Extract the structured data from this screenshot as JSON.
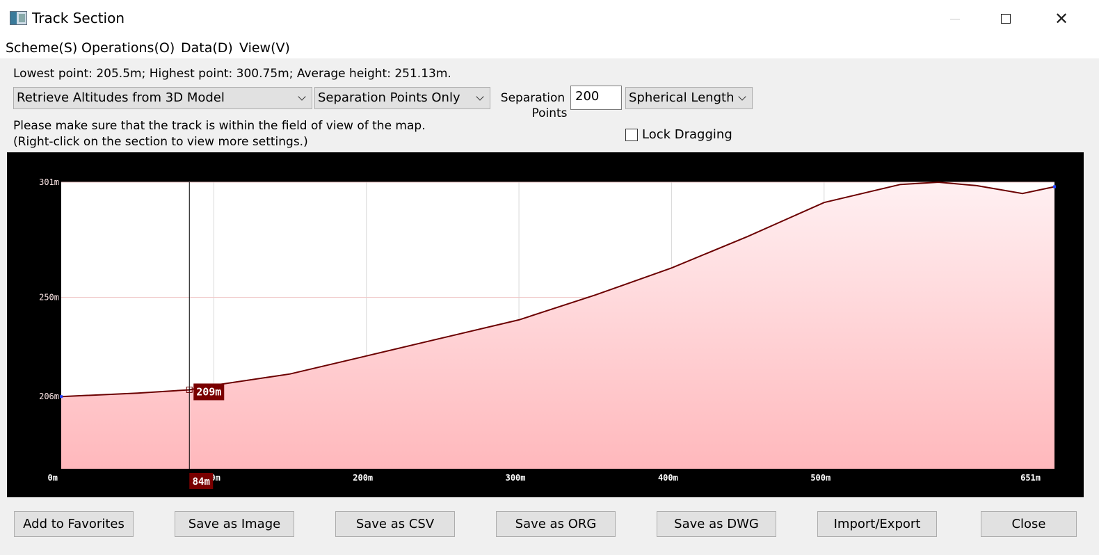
{
  "window": {
    "title": "Track Section"
  },
  "menu": [
    "Scheme(S)",
    "Operations(O)",
    "Data(D)",
    "View(V)"
  ],
  "stats": "Lowest point: 205.5m; Highest point: 300.75m; Average height: 251.13m.",
  "controls": {
    "altitude_source": "Retrieve Altitudes from 3D Model",
    "point_mode": "Separation Points Only",
    "separation_label_1": "Separation",
    "separation_label_2": "Points",
    "separation_value": "200",
    "length_mode": "Spherical Length",
    "lock_dragging": "Lock Dragging"
  },
  "hint": {
    "line1": "Please make sure that the track is within the field of view of the map.",
    "line2": "(Right-click on the section to view more settings.)"
  },
  "chart_data": {
    "type": "area",
    "y_tick_labels": [
      "301m",
      "250m",
      "206m"
    ],
    "y_ticks": [
      301,
      250,
      206
    ],
    "x_tick_labels": [
      "0m",
      "100m",
      "200m",
      "300m",
      "400m",
      "500m",
      "651m"
    ],
    "x_ticks": [
      0,
      100,
      200,
      300,
      400,
      500,
      651
    ],
    "xlim": [
      0,
      651
    ],
    "ylim": [
      174,
      301
    ],
    "x": [
      0,
      50,
      84,
      100,
      150,
      200,
      250,
      300,
      350,
      400,
      450,
      500,
      550,
      575,
      600,
      630,
      651
    ],
    "y": [
      206,
      207.5,
      209,
      211,
      216,
      224,
      232,
      240,
      251,
      263,
      277,
      292,
      300,
      301,
      299.5,
      296,
      299
    ],
    "line_color": "#6b0000",
    "fill_top": "#fff0f2",
    "fill_bottom": "#ffb8bc",
    "cursor": {
      "x": 84,
      "x_label": "84m",
      "y": 209,
      "y_label": "209m"
    }
  },
  "buttons": [
    "Add to Favorites",
    "Save as Image",
    "Save as CSV",
    "Save as ORG",
    "Save as DWG",
    "Import/Export",
    "Close"
  ]
}
